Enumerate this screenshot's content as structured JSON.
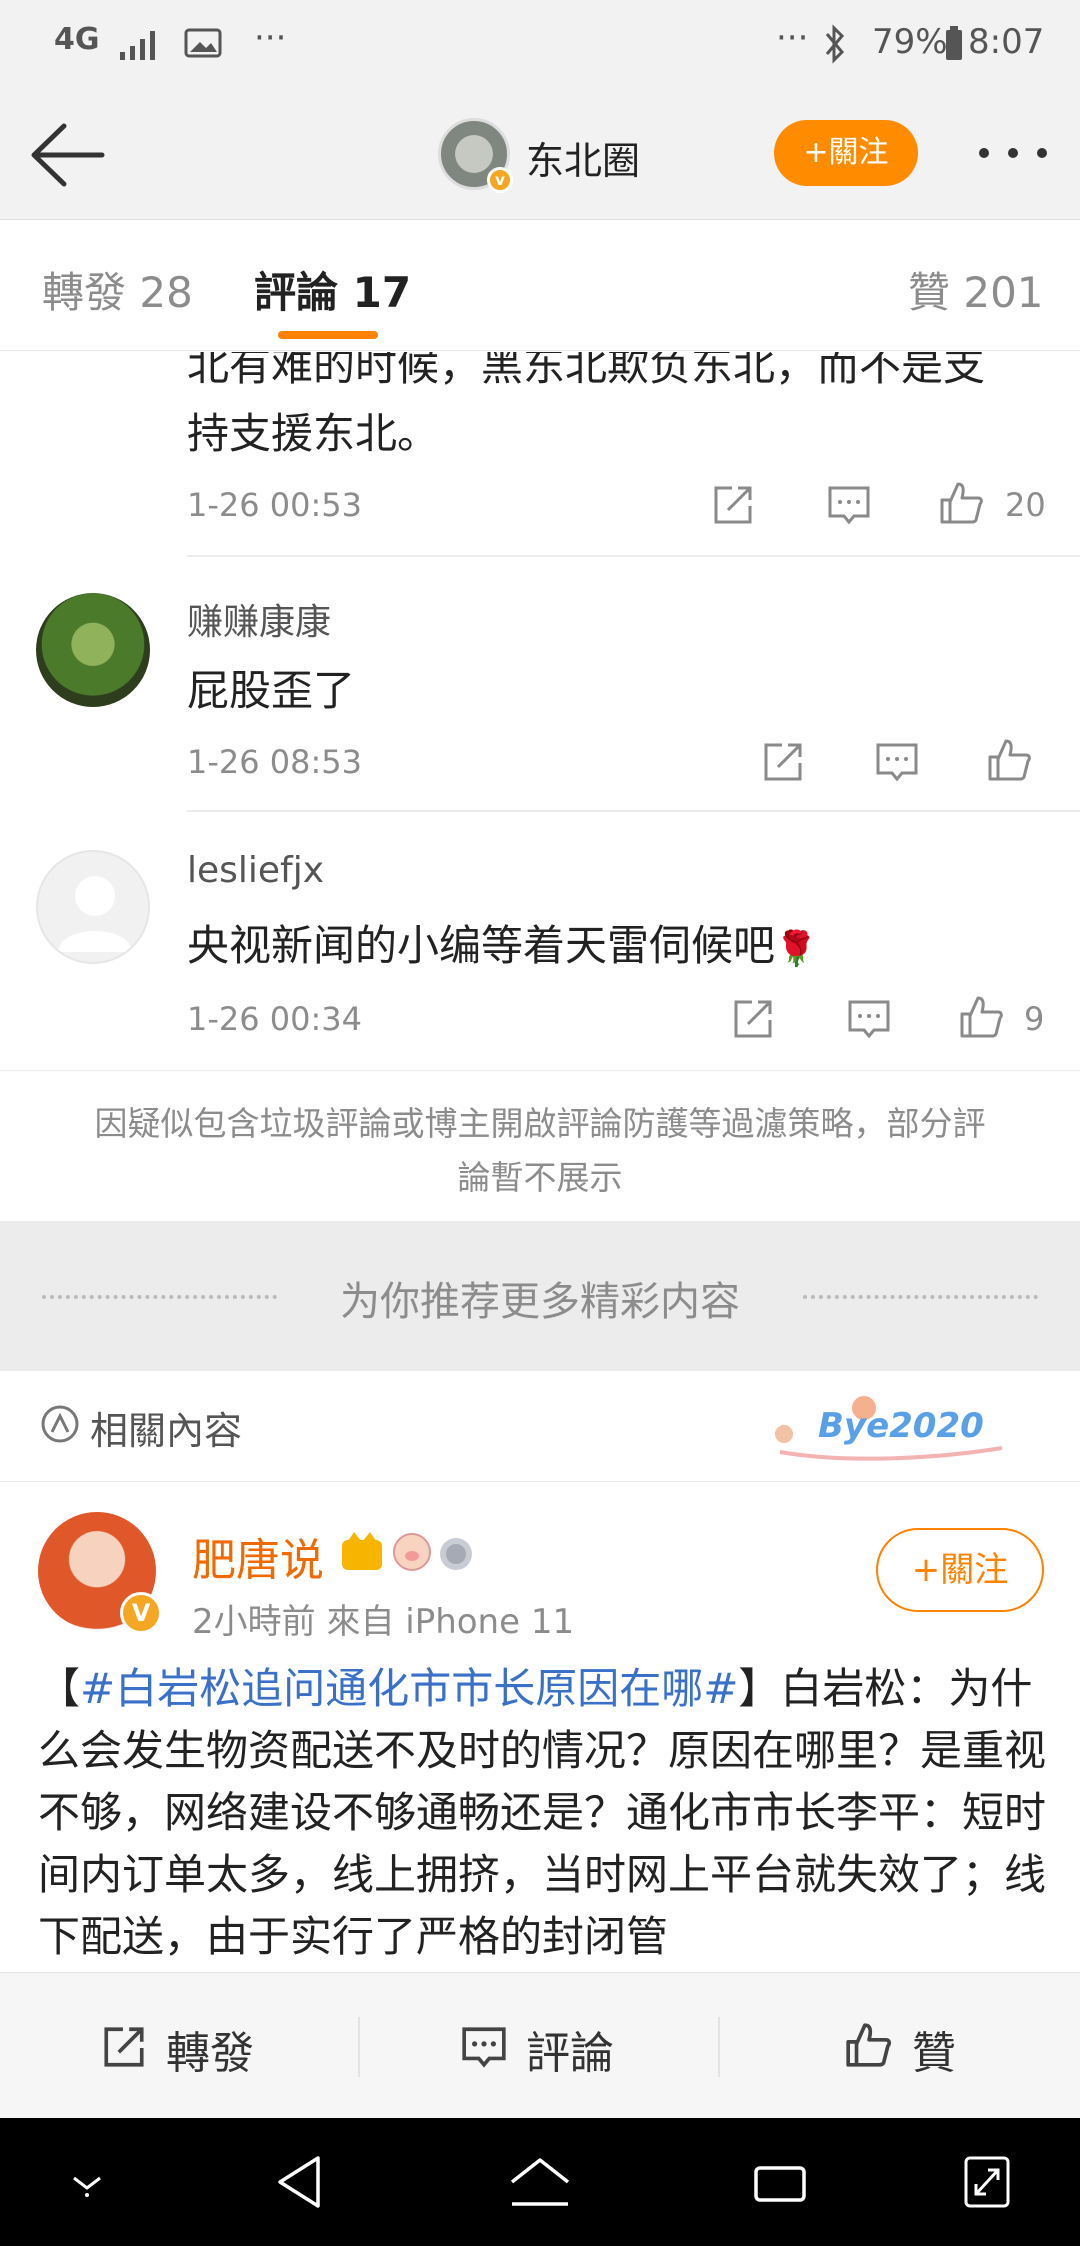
{
  "status_bar": {
    "network": "4G",
    "battery": "79%",
    "time": "8:07",
    "dots": "···"
  },
  "header": {
    "title": "东北圈",
    "follow_label": "+關注"
  },
  "tabs": [
    {
      "label": "轉發 28"
    },
    {
      "label": "評論 17"
    },
    {
      "label": "贊 201"
    }
  ],
  "comments": [
    {
      "text_line1": "北有难的时候，黑东北欺负东北，而不是支",
      "text_line2": "持支援东北。",
      "time": "1-26 00:53",
      "likes": "20"
    },
    {
      "name": "赚赚康康",
      "text": "屁股歪了",
      "time": "1-26 08:53",
      "likes": ""
    },
    {
      "name": "lesliefjx",
      "text": "央视新闻的小编等着天雷伺候吧",
      "time": "1-26 00:34",
      "likes": "9"
    }
  ],
  "notice": "因疑似包含垃圾評論或博主開啟評論防護等過濾策略，部分評論暫不展示",
  "recommend": "为你推荐更多精彩内容",
  "related": {
    "label": "相關內容",
    "badge": "Bye2020"
  },
  "post": {
    "author": "肥唐说",
    "meta": "2小時前   來自 iPhone 11",
    "follow_label": "+關注",
    "topic": "#白岩松追问通化市市长原因在哪#",
    "text": "白岩松：为什么会发生物资配送不及时的情况？原因在哪里？是重视不够，网络建设不够通畅还是？通化市市长李平：短时间内订单太多，线上拥挤，当时网上平台就失效了；线下配送，由于实行了严格的封闭管"
  },
  "actions": [
    {
      "label": "轉發"
    },
    {
      "label": "評論"
    },
    {
      "label": "贊"
    }
  ],
  "colors": {
    "accent": "#ff8200",
    "topic_link": "#3a70c8",
    "author_name": "#f06a00"
  }
}
